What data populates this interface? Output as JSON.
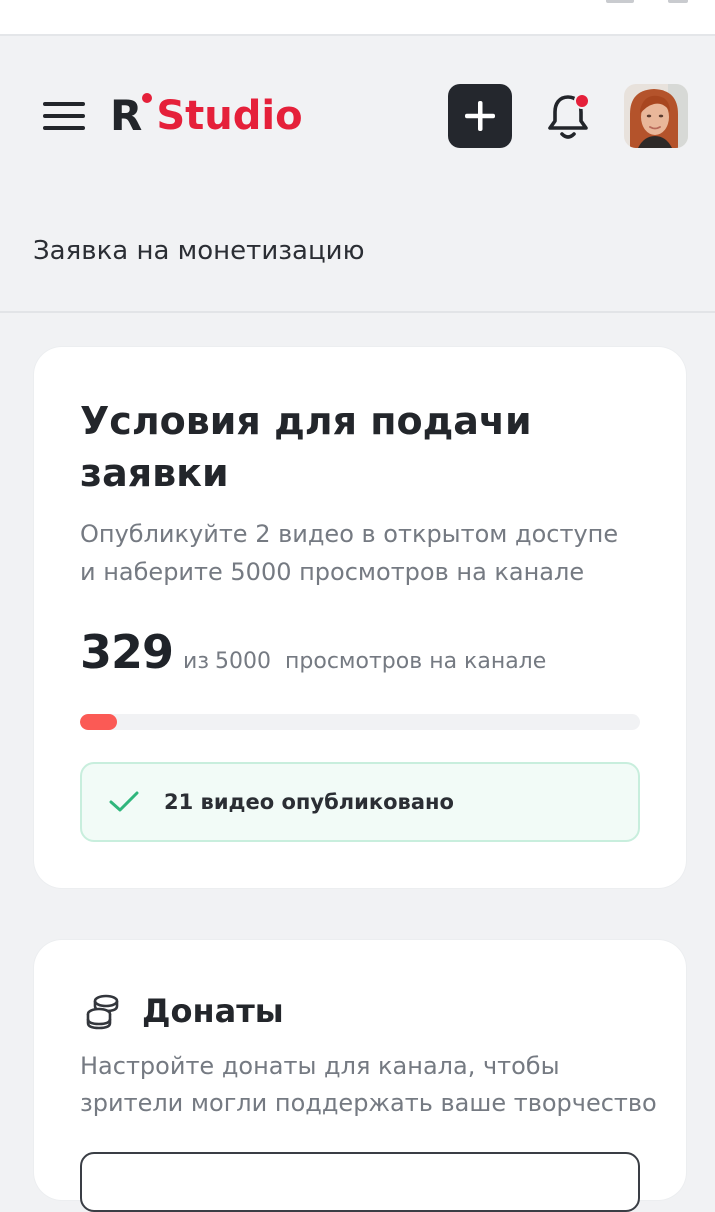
{
  "header": {
    "logo_r": "R",
    "logo_studio": "Studio",
    "menu_icon": "hamburger-menu-icon",
    "add_icon": "plus-icon",
    "bell_icon": "bell-icon",
    "brand_color": "#e5203a"
  },
  "page": {
    "title": "Заявка на монетизацию"
  },
  "conditions": {
    "title": "Условия для подачи заявки",
    "description": "Опубликуйте 2 видео в открытом доступе и наберите 5000 просмотров на канале",
    "views_count": "329",
    "views_of": "из",
    "views_total": "5000",
    "views_suffix": "просмотров на канале",
    "progress_fraction": 0.0658,
    "progress_color": "#fb5a55",
    "published_icon": "check-icon",
    "published_text": "21 видео опубликовано"
  },
  "donates": {
    "icon": "coins-icon",
    "title": "Донаты",
    "description": "Настройте донаты для канала, чтобы зрители могли поддержать ваше творчество"
  }
}
